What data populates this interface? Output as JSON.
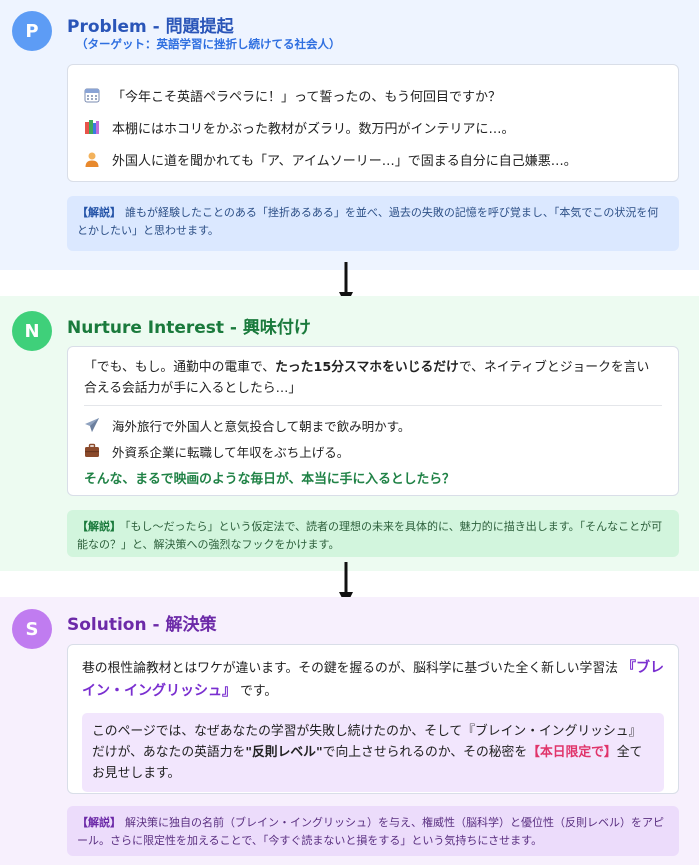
{
  "problem": {
    "badge": "P",
    "title": "Problem - 問題提起",
    "subtitle": "（ターゲット：英語学習に挫折し続けてる社会人）",
    "items": [
      {
        "icon": "calendar-icon",
        "text": "「今年こそ英語ペラペラに！」って誓ったの、もう何回目ですか？"
      },
      {
        "icon": "books-icon",
        "text": "本棚にはホコリをかぶった教材がズラリ。数万円がインテリアに…。"
      },
      {
        "icon": "person-icon",
        "text": "外国人に道を聞かれても「ア、アイムソーリー…」で固まる自分に自己嫌悪…。"
      }
    ],
    "note_tag": "【解説】",
    "note_text": "誰もが経験したことのある「挫折あるある」を並べ、過去の失敗の記憶を呼び覚まし、「本気でこの状況を何とかしたい」と思わせます。"
  },
  "nurture": {
    "badge": "N",
    "title": "Nurture Interest - 興味付け",
    "quote_pre": "「でも、もし。通勤中の電車で、",
    "quote_bold": "たった15分スマホをいじるだけ",
    "quote_post": "で、ネイティブとジョークを言い合える会話力が手に入るとしたら…」",
    "items": [
      {
        "icon": "airplane-icon",
        "text": "海外旅行で外国人と意気投合して朝まで飲み明かす。"
      },
      {
        "icon": "briefcase-icon",
        "text": "外資系企業に転職して年収をぶち上げる。"
      }
    ],
    "highlight": "そんな、まるで映画のような毎日が、本当に手に入るとしたら？",
    "note_tag": "【解説】",
    "note_text": "「もし〜だったら」という仮定法で、読者の理想の未来を具体的に、魅力的に描き出します。「そんなことが可能なの？」と、解決策への強烈なフックをかけます。"
  },
  "solution": {
    "badge": "S",
    "title": "Solution - 解決策",
    "intro_pre": "巷の根性論教材とはワケが違います。その鍵を握るのが、脳科学に基づいた全く新しい学習法",
    "brand": "『ブレイン・イングリッシュ』",
    "intro_post": "です。",
    "box_pre": "このページでは、なぜあなたの学習が失敗し続けたのか、そして『ブレイン・イングリッシュ』だけが、あなたの英語力を",
    "box_bold": "\"反則レベル\"",
    "box_mid": "で向上させられるのか、その秘密を",
    "box_limit": "【本日限定で】",
    "box_post": "全てお見せします。",
    "note_tag": "【解説】",
    "note_text": "解決策に独自の名前（ブレイン・イングリッシュ）を与え、権威性（脳科学）と優位性（反則レベル）をアピール。さらに限定性を加えることで、「今すぐ読まないと損をする」という気持ちにさせます。"
  },
  "colors": {
    "problem_accent": "#5d9cf5",
    "nurture_accent": "#3fd07a",
    "solution_accent": "#c07cf0"
  }
}
